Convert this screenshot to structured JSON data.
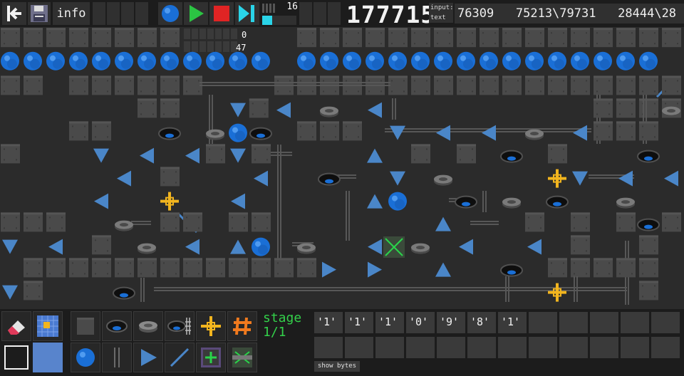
{
  "toolbar": {
    "back_icon": "exit-back-icon",
    "save_icon": "floppy-disk-save-icon",
    "info_label": "info",
    "marble_icon": "blue-marble-icon",
    "play_icon": "play-icon",
    "stop_icon": "stop-icon",
    "step_icon": "step-forward-icon",
    "speed_value": "16",
    "speed_fraction": 0.3,
    "counter": "177715",
    "input_label": "input:",
    "text_label": "text",
    "output_text": "76309   75213\\79731   28444\\28"
  },
  "board": {
    "overlay_top": "0",
    "overlay_bottom": "47",
    "colors": {
      "background": "#2b2b2b",
      "block": "#4a4a4a",
      "marble": "#1a6fd6",
      "arrow": "#4a86c8",
      "cross": "#f2b51e",
      "rail": "#575757"
    }
  },
  "palette": {
    "row1": [
      {
        "name": "eraser-tool",
        "icon": "eraser-icon"
      },
      {
        "name": "grid-select-tool",
        "icon": "grid-select-icon"
      },
      {
        "name": "block-tool",
        "icon": "block-icon"
      },
      {
        "name": "hole-tool",
        "icon": "hole-icon"
      },
      {
        "name": "disc-tool",
        "icon": "disc-icon"
      },
      {
        "name": "hole-rail-tool",
        "icon": "hole-rail-icon"
      },
      {
        "name": "crossing-tool",
        "icon": "crossing-icon"
      },
      {
        "name": "hash-tool",
        "icon": "hash-icon"
      }
    ],
    "row2": [
      {
        "name": "region-select-tool",
        "icon": "region-select-icon"
      },
      {
        "name": "color-swatch",
        "icon": "color-swatch-icon"
      },
      {
        "name": "marble-tool",
        "icon": "marble-icon"
      },
      {
        "name": "rail-tool",
        "icon": "rail-icon"
      },
      {
        "name": "arrow-tool",
        "icon": "arrow-right-icon"
      },
      {
        "name": "diagonal-tool",
        "icon": "diagonal-icon"
      },
      {
        "name": "counter-tool",
        "icon": "counter-box-icon"
      },
      {
        "name": "switch-tool",
        "icon": "switch-box-icon"
      }
    ],
    "stage_label": "stage",
    "stage_value": "1/1"
  },
  "bytes": [
    "'1'",
    "'1'",
    "'1'",
    "'0'",
    "'9'",
    "'8'",
    "'1'"
  ],
  "show_bytes_label": "show bytes"
}
